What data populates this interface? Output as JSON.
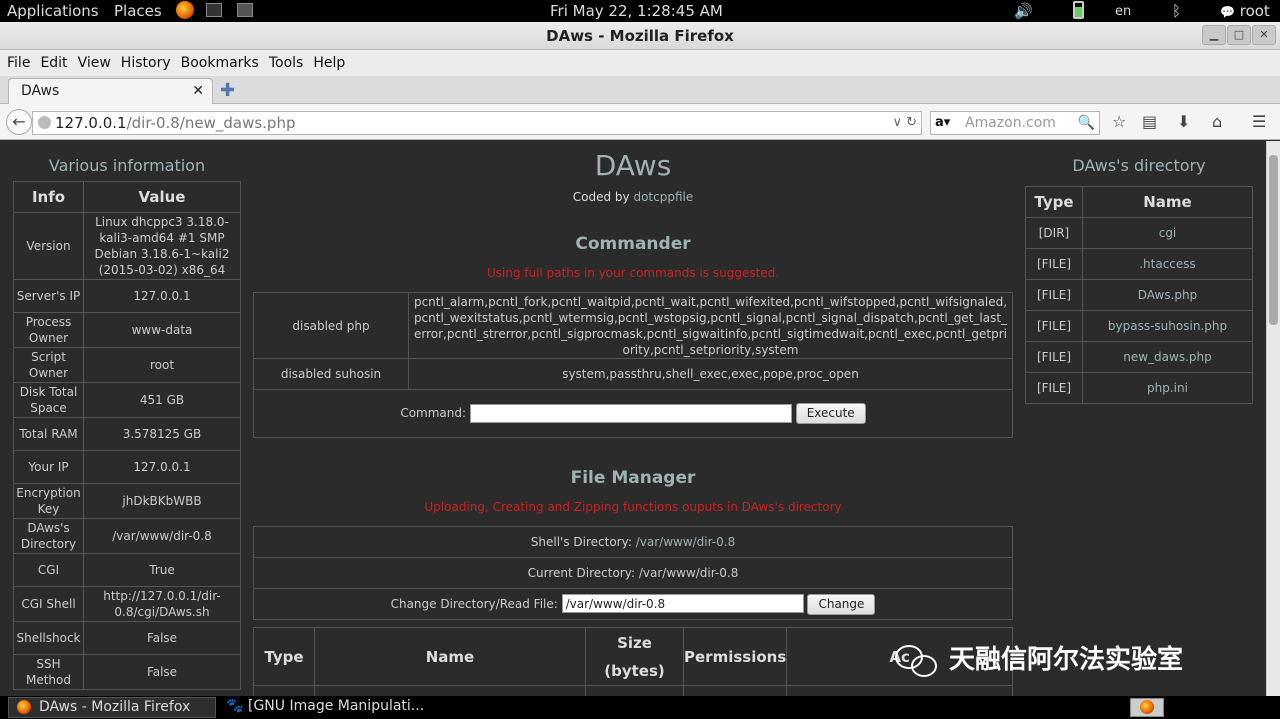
{
  "topbar": {
    "applications": "Applications",
    "places": "Places",
    "clock": "Fri May 22,  1:28:45 AM",
    "lang": "en",
    "user": "root"
  },
  "window": {
    "title": "DAws - Mozilla Firefox"
  },
  "menu": [
    "File",
    "Edit",
    "View",
    "History",
    "Bookmarks",
    "Tools",
    "Help"
  ],
  "tab": {
    "title": "DAws"
  },
  "url": {
    "host": "127.0.0.1",
    "path": "/dir-0.8/new_daws.php"
  },
  "search": {
    "placeholder": "Amazon.com",
    "engine": "a"
  },
  "info_panel": {
    "title": "Various information",
    "col_info": "Info",
    "col_value": "Value",
    "rows": [
      {
        "k": "Version",
        "v": "Linux dhcppc3 3.18.0-kali3-amd64 #1 SMP Debian 3.18.6-1~kali2 (2015-03-02) x86_64"
      },
      {
        "k": "Server's IP",
        "v": "127.0.0.1"
      },
      {
        "k": "Process Owner",
        "v": "www-data"
      },
      {
        "k": "Script Owner",
        "v": "root"
      },
      {
        "k": "Disk Total Space",
        "v": "451 GB"
      },
      {
        "k": "Total RAM",
        "v": "3.578125 GB"
      },
      {
        "k": "Your IP",
        "v": "127.0.0.1"
      },
      {
        "k": "Encryption Key",
        "v": "jhDkBKbWBB"
      },
      {
        "k": "DAws's Directory",
        "v": "/var/www/dir-0.8"
      },
      {
        "k": "CGI",
        "v": "True"
      },
      {
        "k": "CGI Shell",
        "v": "http://127.0.0.1/dir-0.8/cgi/DAws.sh"
      },
      {
        "k": "Shellshock",
        "v": "False"
      },
      {
        "k": "SSH Method",
        "v": "False"
      }
    ]
  },
  "header": {
    "title": "DAws",
    "coded_by": "Coded by",
    "author": "dotcppfile"
  },
  "commander": {
    "title": "Commander",
    "note": "Using full paths in your commands is suggested.",
    "disabled_php_label": "disabled php",
    "disabled_php_value": "pcntl_alarm,pcntl_fork,pcntl_waitpid,pcntl_wait,pcntl_wifexited,pcntl_wifstopped,pcntl_wifsignaled,pcntl_wexitstatus,pcntl_wtermsig,pcntl_wstopsig,pcntl_signal,pcntl_signal_dispatch,pcntl_get_last_error,pcntl_strerror,pcntl_sigprocmask,pcntl_sigwaitinfo,pcntl_sigtimedwait,pcntl_exec,pcntl_getpriority,pcntl_setpriority,system",
    "disabled_suhosin_label": "disabled suhosin",
    "disabled_suhosin_value": "system,passthru,shell_exec,exec,pope,proc_open",
    "command_label": "Command:",
    "command_value": "",
    "execute": "Execute"
  },
  "file_manager": {
    "title": "File Manager",
    "note": "Uploading, Creating and Zipping functions ouputs in DAws's directory",
    "shell_dir_label": "Shell's Directory:",
    "shell_dir_value": "/var/www/dir-0.8",
    "current_dir_label": "Current Directory:",
    "current_dir_value": "/var/www/dir-0.8",
    "change_label": "Change Directory/Read File:",
    "change_value": "/var/www/dir-0.8",
    "change_button": "Change",
    "columns": [
      "Type",
      "Name",
      "Size (bytes)",
      "Permissions",
      "Ac"
    ]
  },
  "directory_panel": {
    "title": "DAws's directory",
    "col_type": "Type",
    "col_name": "Name",
    "rows": [
      {
        "type": "[DIR]",
        "name": "cgi"
      },
      {
        "type": "[FILE]",
        "name": ".htaccess"
      },
      {
        "type": "[FILE]",
        "name": "DAws.php"
      },
      {
        "type": "[FILE]",
        "name": "bypass-suhosin.php"
      },
      {
        "type": "[FILE]",
        "name": "new_daws.php"
      },
      {
        "type": "[FILE]",
        "name": "php.ini"
      }
    ]
  },
  "watermark": "天融信阿尔法实验室",
  "taskbar": {
    "task1": "DAws - Mozilla Firefox",
    "task2": "[GNU Image Manipulati..."
  },
  "colors": {
    "page_bg": "#2b2b2b",
    "accent": "#9fb3b6",
    "warning": "#cc2222"
  }
}
